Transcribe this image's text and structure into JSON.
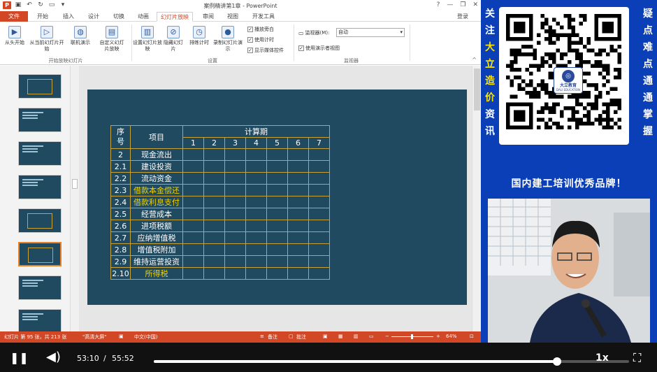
{
  "titlebar": {
    "doc_title": "案例精讲第1章 - PowerPoint",
    "window_controls": [
      "?",
      "—",
      "❐",
      "✕"
    ]
  },
  "tabs": [
    {
      "label": "文件",
      "id": "file"
    },
    {
      "label": "开始",
      "id": "home"
    },
    {
      "label": "插入",
      "id": "insert"
    },
    {
      "label": "设计",
      "id": "design"
    },
    {
      "label": "切换",
      "id": "transitions"
    },
    {
      "label": "动画",
      "id": "animations"
    },
    {
      "label": "幻灯片放映",
      "id": "slideshow"
    },
    {
      "label": "审阅",
      "id": "review"
    },
    {
      "label": "视图",
      "id": "view"
    },
    {
      "label": "开发工具",
      "id": "developer"
    }
  ],
  "login": "登录",
  "ribbon": {
    "from_beginning": "从头开始",
    "from_current": "从当前幻灯片开始",
    "present_online": "联机演示",
    "custom_show": "自定义幻灯片放映",
    "group_start": "开始放映幻灯片",
    "setup_show": "设置幻灯片放映",
    "hide_slide": "隐藏幻灯片",
    "rehearse": "排练计时",
    "record": "录制幻灯片演示",
    "play_narrations": "播放旁白",
    "use_timings": "使用计时",
    "show_media_controls": "显示媒体控件",
    "group_setup": "设置",
    "monitor_label": "监视器(M):",
    "monitor_value": "自动",
    "presenter_view": "使用演示者视图",
    "group_monitors": "监视器"
  },
  "thumbnails": [
    {
      "num": "",
      "selected": false
    },
    {
      "num": "",
      "selected": false
    },
    {
      "num": "",
      "selected": false
    },
    {
      "num": "",
      "selected": false
    },
    {
      "num": "",
      "selected": false
    },
    {
      "num": "",
      "selected": true
    },
    {
      "num": "",
      "selected": false
    },
    {
      "num": "",
      "selected": false
    }
  ],
  "slide_table": {
    "seq_header": "序号",
    "item_header": "项目",
    "period_header": "计算期",
    "periods": [
      "1",
      "2",
      "3",
      "4",
      "5",
      "6",
      "7"
    ],
    "rows": [
      {
        "seq": "2",
        "item": "现金流出",
        "highlight": false
      },
      {
        "seq": "2.1",
        "item": "建设投资",
        "highlight": false
      },
      {
        "seq": "2.2",
        "item": "流动资金",
        "highlight": false
      },
      {
        "seq": "2.3",
        "item": "借款本金偿还",
        "highlight": true
      },
      {
        "seq": "2.4",
        "item": "借款利息支付",
        "highlight": true
      },
      {
        "seq": "2.5",
        "item": "经营成本",
        "highlight": false
      },
      {
        "seq": "2.6",
        "item": "进项税额",
        "highlight": false
      },
      {
        "seq": "2.7",
        "item": "应纳增值税",
        "highlight": false
      },
      {
        "seq": "2.8",
        "item": "增值税附加",
        "highlight": false
      },
      {
        "seq": "2.9",
        "item": "维持运营投资",
        "highlight": false
      },
      {
        "seq": "2.10",
        "item": "所得税",
        "highlight": true
      }
    ]
  },
  "statusbar": {
    "slide_info": "幻灯片 第 95 张，共 213 张",
    "theme": "\"高清大屏\"",
    "language": "中文(中国)",
    "notes": "备注",
    "comments": "批注",
    "zoom": "64%"
  },
  "promo": {
    "left_text": [
      "关",
      "注",
      "大",
      "立",
      "造",
      "价",
      "资",
      "讯"
    ],
    "left_yellow": [
      2,
      3,
      4,
      5
    ],
    "right_text": [
      "疑",
      "点",
      "难",
      "点",
      "通",
      "通",
      "掌",
      "握"
    ],
    "logo_cn": "大立教育",
    "logo_en": "DALI EDUCATION",
    "banner": "国内建工培训优秀品牌！"
  },
  "player": {
    "current_time": "53:10",
    "total_time": "55:52",
    "speed": "1x",
    "progress": 0.848
  },
  "colors": {
    "ppt_accent": "#d24726",
    "slide_bg": "#1f4a60",
    "table_border": "#c9a23a",
    "highlight_text": "#f0d200",
    "promo_bg": "#0a3fb8"
  }
}
